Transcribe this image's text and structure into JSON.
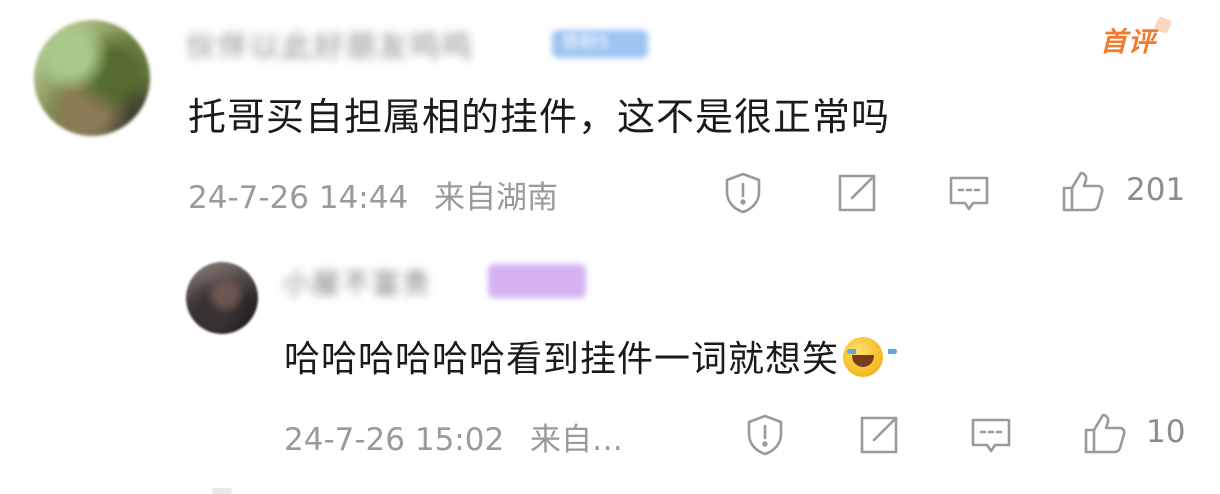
{
  "comments": [
    {
      "username": "伙伴以此好朋友鸣鸣",
      "badge": "铁粉5",
      "first_comment_tag": "首评",
      "text": "托哥买自担属相的挂件，这不是很正常吗",
      "timestamp": "24-7-26 14:44",
      "location": "来自湖南",
      "likes": "201"
    },
    {
      "username": "小屋不富贵",
      "badge": "",
      "text": "哈哈哈哈哈哈看到挂件一词就想笑",
      "emoji": "laughing-crying-emoji",
      "timestamp": "24-7-26 15:02",
      "location": "来自…",
      "likes": "10"
    }
  ],
  "icons": [
    "report-icon",
    "share-icon",
    "reply-icon",
    "like-icon"
  ],
  "colors": {
    "text": "#1a1a1a",
    "meta": "#9a9a9a",
    "first_tag": "#f07a2e",
    "badge_blue": "#9ec4f2",
    "badge_purple": "#d6b1f2"
  }
}
